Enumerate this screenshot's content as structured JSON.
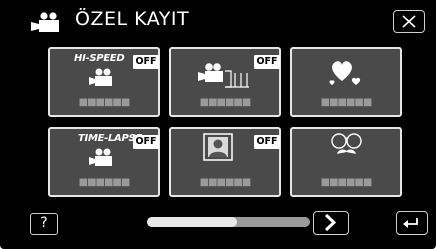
{
  "header": {
    "title": "ÖZEL KAYIT",
    "mode_icon": "movie-camera-icon",
    "close_icon": "close-icon"
  },
  "tiles": [
    {
      "name": "HI-SPEED",
      "badge": "OFF",
      "icon": "movie-camera-icon",
      "label": "■■■■■■"
    },
    {
      "name": "",
      "badge": "OFF",
      "icon": "movie-camera-frames-icon",
      "label": "■■■■■■"
    },
    {
      "name": "",
      "badge": "",
      "icon": "hearts-icon",
      "label": "■■■■■■"
    },
    {
      "name": "TIME-LAPSE",
      "badge": "OFF",
      "icon": "movie-camera-icon",
      "label": "■■■■■■"
    },
    {
      "name": "",
      "badge": "OFF",
      "icon": "portrait-frame-icon",
      "label": "■■■■■■"
    },
    {
      "name": "",
      "badge": "",
      "icon": "glasses-mustache-icon",
      "label": "■■■■■■"
    }
  ],
  "footer": {
    "help_label": "?",
    "scroll_position": 0.55,
    "next_icon": "chevron-right-icon",
    "back_icon": "return-arrow-icon"
  },
  "colors": {
    "background": "#000000",
    "tile": "#4a4a4a",
    "tile_border": "#e6e6e6",
    "text": "#ffffff"
  }
}
